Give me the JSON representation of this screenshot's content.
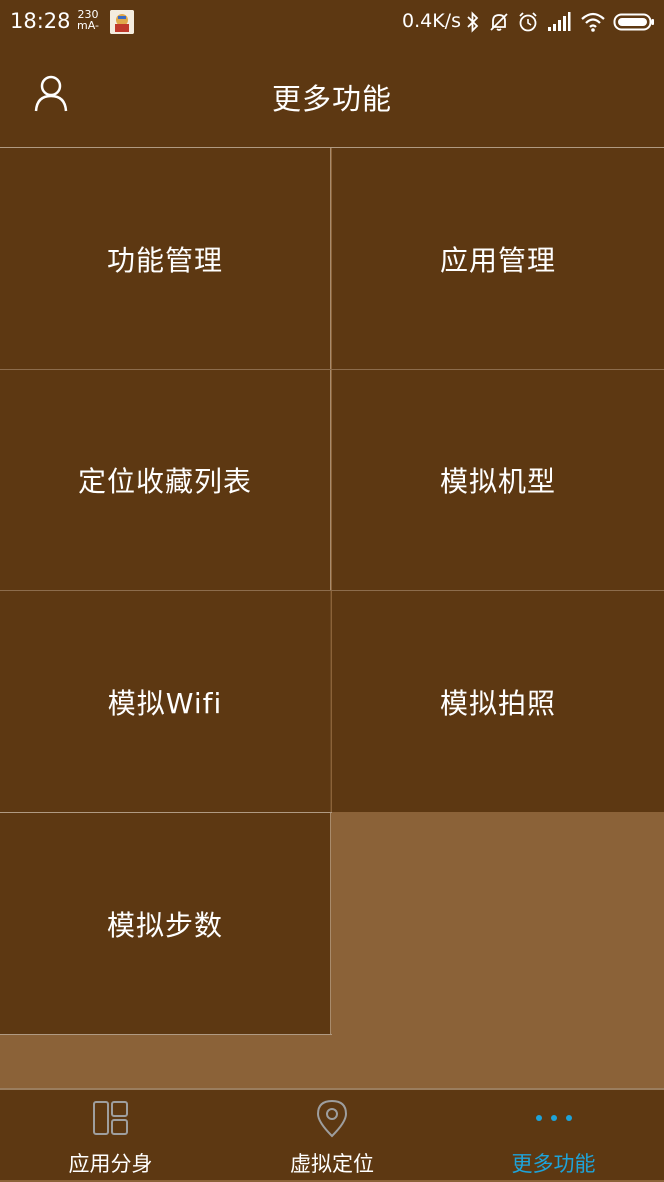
{
  "status_bar": {
    "time": "18:28",
    "current_value": "230",
    "current_unit": "mA-",
    "net_speed": "0.4K/s"
  },
  "app_bar": {
    "title": "更多功能"
  },
  "grid": {
    "items": [
      {
        "label": "功能管理"
      },
      {
        "label": "应用管理"
      },
      {
        "label": "定位收藏列表"
      },
      {
        "label": "模拟机型"
      },
      {
        "label": "模拟Wifi"
      },
      {
        "label": "模拟拍照"
      },
      {
        "label": "模拟步数"
      }
    ]
  },
  "bottom_nav": {
    "items": [
      {
        "label": "应用分身",
        "icon": "layout-icon"
      },
      {
        "label": "虚拟定位",
        "icon": "location-pin-icon"
      },
      {
        "label": "更多功能",
        "icon": "more-dots-icon",
        "active": true
      }
    ]
  },
  "colors": {
    "bar_background": "#5D3812",
    "page_background": "#8B6238",
    "accent": "#1EA3D9",
    "text": "#FFFFFF"
  }
}
